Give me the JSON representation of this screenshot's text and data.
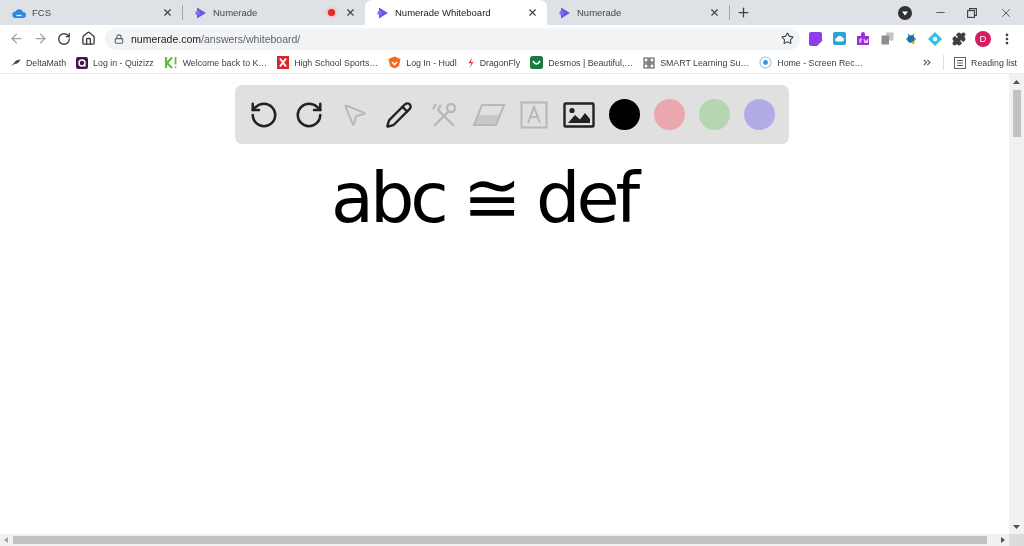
{
  "tabs": [
    {
      "title": "FCS",
      "kind": "cloud",
      "selected": false,
      "recording": false
    },
    {
      "title": "Numerade",
      "kind": "numerade",
      "selected": false,
      "recording": true
    },
    {
      "title": "Numerade Whiteboard",
      "kind": "numerade",
      "selected": true,
      "recording": false
    },
    {
      "title": "Numerade",
      "kind": "numerade",
      "selected": false,
      "recording": false
    }
  ],
  "address_bar": {
    "host": "numerade.com",
    "path": "/answers/whiteboard/"
  },
  "profile": {
    "initial": "D"
  },
  "bookmarks": [
    {
      "label": "DeltaMath",
      "kind": "feather"
    },
    {
      "label": "Log in - Quizizz",
      "kind": "ring-tile"
    },
    {
      "label": "Welcome back to K…",
      "kind": "k-mark"
    },
    {
      "label": "High School Sports…",
      "kind": "x-tile"
    },
    {
      "label": "Log In - Hudl",
      "kind": "shield"
    },
    {
      "label": "DragonFly",
      "kind": "flame"
    },
    {
      "label": "Desmos | Beautiful,…",
      "kind": "smile-tile"
    },
    {
      "label": "SMART Learning Su…",
      "kind": "pattern"
    },
    {
      "label": "Home - Screen Rec…",
      "kind": "target"
    }
  ],
  "reading_list": {
    "label": "Reading list"
  },
  "whiteboard": {
    "tools": [
      {
        "kind": "undo",
        "disabled": false
      },
      {
        "kind": "redo",
        "disabled": false
      },
      {
        "kind": "select",
        "disabled": true
      },
      {
        "kind": "pen",
        "disabled": false
      },
      {
        "kind": "shapes",
        "disabled": true
      },
      {
        "kind": "eraser",
        "disabled": true
      },
      {
        "kind": "text",
        "disabled": true
      },
      {
        "kind": "image",
        "disabled": false
      }
    ],
    "colors": [
      {
        "color": "#000000"
      },
      {
        "color": "#e8a8ad"
      },
      {
        "color": "#b4d6b1"
      },
      {
        "color": "#b1ace6"
      }
    ],
    "ink": "abc ≅ def"
  }
}
